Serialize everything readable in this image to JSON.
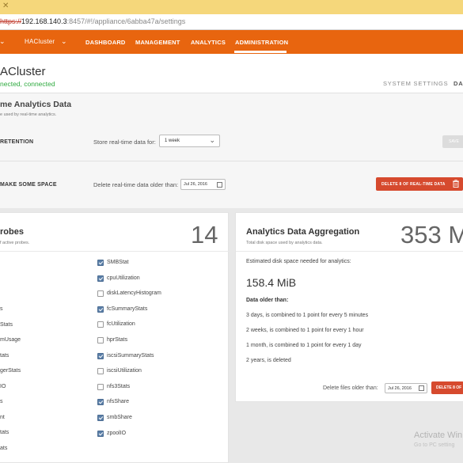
{
  "browser": {
    "tab_close": "✕",
    "url_proto": "https://",
    "url_host": "192.168.140.3",
    "url_path": ":8457/#!/appliance/6abba47a/settings"
  },
  "nav": {
    "cluster_label": "HACluster",
    "items": [
      "DASHBOARD",
      "MANAGEMENT",
      "ANALYTICS",
      "ADMINISTRATION"
    ],
    "active": "ADMINISTRATION"
  },
  "header": {
    "cluster_name": "ACluster",
    "status": "nected, connected",
    "tabs": [
      "SYSTEM SETTINGS",
      "DA"
    ]
  },
  "realtime": {
    "title": "me Analytics Data",
    "subtitle": "e used by real-time analytics.",
    "retention_label": "RETENTION",
    "store_label": "Store real-time data for:",
    "store_value": "1 week",
    "save_label": "SAVE",
    "space_label": "MAKE SOME SPACE",
    "delete_label": "Delete real-time data older than:",
    "delete_date": "Jul 26, 2016",
    "delete_button": "DELETE 8 OF REAL-TIME DATA"
  },
  "probes": {
    "title": "robes",
    "subtitle": "f active probes.",
    "count": "14",
    "left_items": [
      "s",
      "Stats",
      "mUsage",
      "tats",
      "gerStats",
      "IO",
      "s",
      "nt",
      "tats",
      "ats"
    ],
    "right_items": [
      {
        "name": "SMBStat",
        "checked": true
      },
      {
        "name": "cpuUtilization",
        "checked": true
      },
      {
        "name": "diskLatencyHistogram",
        "checked": false
      },
      {
        "name": "fcSummaryStats",
        "checked": true
      },
      {
        "name": "fcUtilization",
        "checked": false
      },
      {
        "name": "hprStats",
        "checked": false
      },
      {
        "name": "iscsiSummaryStats",
        "checked": true
      },
      {
        "name": "iscsiUtilization",
        "checked": false
      },
      {
        "name": "nfs3Stats",
        "checked": false
      },
      {
        "name": "nfsShare",
        "checked": true
      },
      {
        "name": "smbShare",
        "checked": true
      },
      {
        "name": "zpoolIO",
        "checked": true
      }
    ]
  },
  "aggregation": {
    "title": "Analytics Data Aggregation",
    "subtitle": "Total disk space used by analytics data.",
    "size": "353 M",
    "estimate_label": "Estimated disk space needed for analytics:",
    "estimate_value": "158.4 MiB",
    "older_label": "Data older than:",
    "rules": [
      "3 days, is combined to 1 point for every 5 minutes",
      "2 weeks, is combined to 1 point for every 1 hour",
      "1 month, is combined to 1 point for every 1 day",
      "2 years, is deleted"
    ],
    "delete_label": "Delete files older than:",
    "delete_date": "Jul 26, 2016",
    "delete_button": "DELETE 8 OF"
  },
  "watermark": {
    "line1": "Activate Win",
    "line2": "Go to PC setting"
  },
  "colors": {
    "nav_bg": "#e8650f",
    "accent_red": "#d64a2e",
    "status_green": "#2eaa3f",
    "checkbox_blue": "#5b7fa8"
  }
}
